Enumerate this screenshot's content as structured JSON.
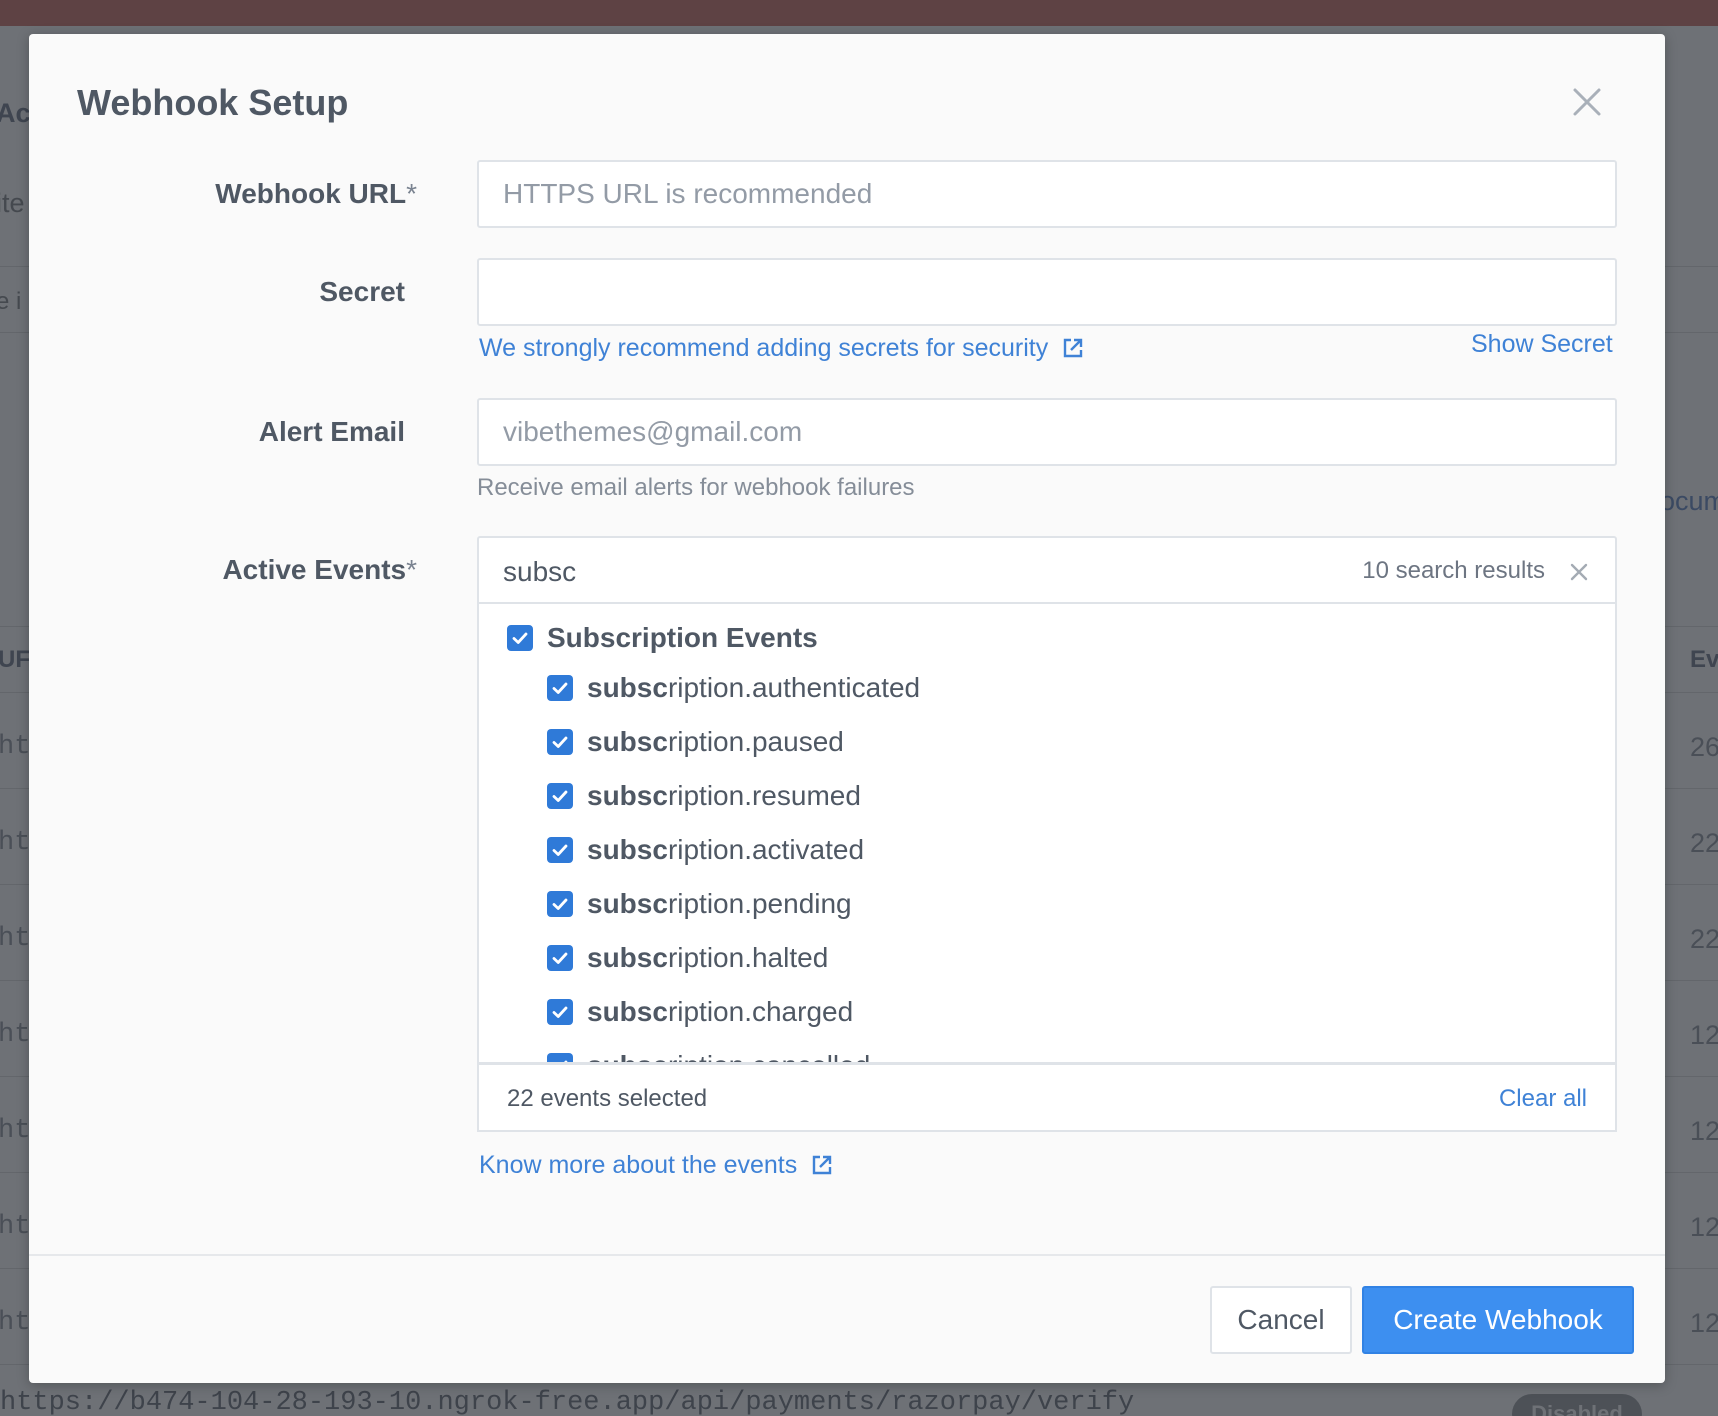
{
  "background": {
    "left_labels": [
      "Ac",
      "ite",
      "e i",
      "UF"
    ],
    "right_labels": [
      "ocum",
      "Ev"
    ],
    "row_prefix": "ht",
    "row_counts": [
      "26",
      "22",
      "22",
      "12",
      "12",
      "12",
      "12"
    ],
    "bottom_url": "https://b474-104-28-193-10.ngrok-free.app/api/payments/razorpay/verify",
    "status_badge": "Disabled"
  },
  "modal": {
    "title": "Webhook Setup",
    "webhook_url": {
      "label": "Webhook URL",
      "required_mark": "*",
      "placeholder": "HTTPS URL is recommended",
      "value": ""
    },
    "secret": {
      "label": "Secret",
      "value": "",
      "recommend_link": "We strongly recommend adding secrets for security",
      "show_secret": "Show Secret"
    },
    "alert_email": {
      "label": "Alert Email",
      "placeholder": "vibethemes@gmail.com",
      "helper": "Receive email alerts for webhook failures"
    },
    "active_events": {
      "label": "Active Events",
      "required_mark": "*",
      "search_query": "subsc",
      "results_count": "10 search results",
      "group": {
        "label": "Subscription Events",
        "checked": true
      },
      "match_text": "subsc",
      "events": [
        {
          "match": "subsc",
          "rest": "ription.authenticated",
          "checked": true
        },
        {
          "match": "subsc",
          "rest": "ription.paused",
          "checked": true
        },
        {
          "match": "subsc",
          "rest": "ription.resumed",
          "checked": true
        },
        {
          "match": "subsc",
          "rest": "ription.activated",
          "checked": true
        },
        {
          "match": "subsc",
          "rest": "ription.pending",
          "checked": true
        },
        {
          "match": "subsc",
          "rest": "ription.halted",
          "checked": true
        },
        {
          "match": "subsc",
          "rest": "ription.charged",
          "checked": true
        },
        {
          "match": "subsc",
          "rest": "ription.cancelled",
          "checked": true
        }
      ],
      "selected_count": "22 events selected",
      "clear_all": "Clear all",
      "know_more_link": "Know more about the events"
    },
    "buttons": {
      "cancel": "Cancel",
      "create": "Create Webhook"
    }
  },
  "colors": {
    "accent": "#3d8ff0",
    "link": "#3f82d6",
    "checkbox": "#2f7ad8",
    "overlay": "#6e7176"
  }
}
